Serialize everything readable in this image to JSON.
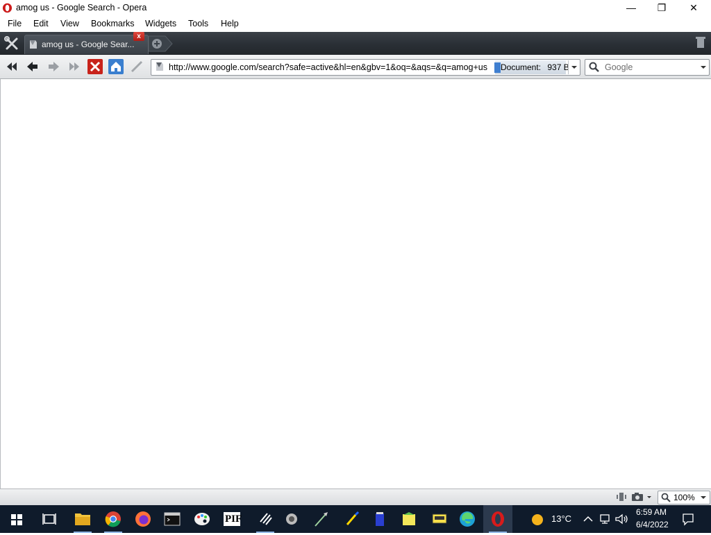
{
  "window": {
    "title": "amog us - Google Search - Opera",
    "app_icon": "opera-icon",
    "controls": {
      "minimize": "—",
      "restore": "❐",
      "close": "✕"
    }
  },
  "menu": [
    "File",
    "Edit",
    "View",
    "Bookmarks",
    "Widgets",
    "Tools",
    "Help"
  ],
  "tabs": [
    {
      "title": "amog us - Google Sear...",
      "active": true
    }
  ],
  "tab_close": "x",
  "navigation": {
    "url": "http://www.google.com/search?safe=active&hl=en&gbv=1&oq=&aqs=&q=amog+us",
    "doc_label": "Document:",
    "doc_size": "937 B",
    "search_placeholder": "Google"
  },
  "statusbar": {
    "zoom": "100%"
  },
  "taskbar": {
    "apps": [
      "windows-start-icon",
      "task-view-icon",
      "file-explorer-icon",
      "chrome-icon",
      "firefox-icon",
      "terminal-icon",
      "paint-icon",
      "pif-icon",
      "pen-tool-icon",
      "gear-app-icon",
      "brush-icon",
      "marker-icon",
      "jar-icon",
      "paint-bucket-icon",
      "pdf-icon",
      "edge-icon",
      "opera-icon"
    ],
    "pif_label": "PIF",
    "weather": "13°C",
    "time": "6:59 AM",
    "date": "6/4/2022"
  },
  "colors": {
    "accent": "#2f7fd4",
    "taskbar": "#0f1b2b",
    "tabbar": "#2a2f35",
    "opera_red": "#cc1b1b"
  }
}
